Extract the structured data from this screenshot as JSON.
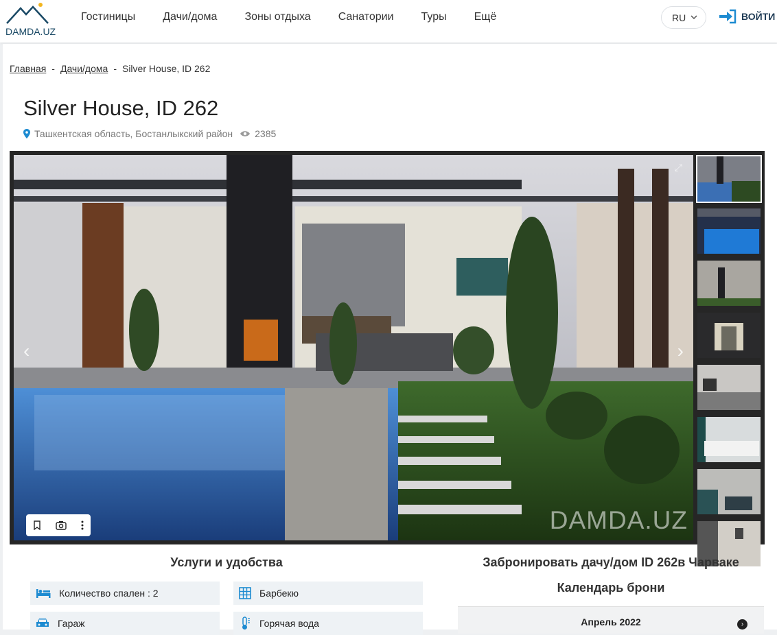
{
  "header": {
    "logo_text": "DAMDA.UZ",
    "nav": [
      "Гостиницы",
      "Дачи/дома",
      "Зоны отдыха",
      "Санатории",
      "Туры",
      "Ещё"
    ],
    "lang": "RU",
    "login_label": "ВОЙТИ"
  },
  "breadcrumbs": {
    "home": "Главная",
    "section": "Дачи/дома",
    "current": "Silver House, ID 262",
    "sep": "-"
  },
  "listing": {
    "title": "Silver House, ID 262",
    "location": "Ташкентская область, Бостанлыкский район",
    "views": "2385"
  },
  "gallery": {
    "watermark": "DAMDA.UZ",
    "thumb_count": 8
  },
  "amenities": {
    "title": "Услуги и удобства",
    "items": [
      {
        "label": "Количество спален : 2",
        "icon": "bed-icon"
      },
      {
        "label": "Барбекю",
        "icon": "grid-icon"
      },
      {
        "label": "Гараж",
        "icon": "car-icon"
      },
      {
        "label": "Горячая вода",
        "icon": "thermometer-icon"
      }
    ]
  },
  "booking": {
    "title": "Забронировать дачу/дом ID 262в Чарваке",
    "calendar_title": "Календарь брони",
    "month": "Апрель 2022"
  },
  "colors": {
    "accent": "#1d8bd1",
    "brand": "#1b4a66"
  }
}
